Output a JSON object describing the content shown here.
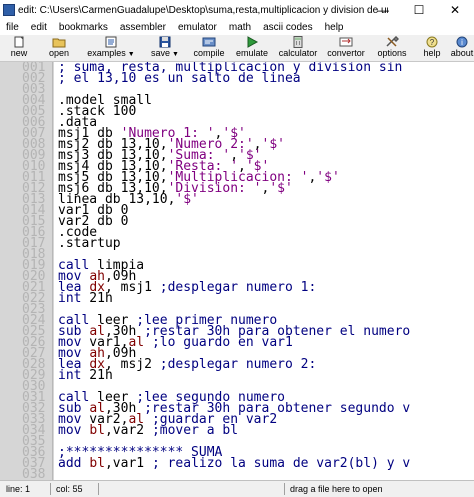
{
  "window": {
    "title": "edit: C:\\Users\\CarmenGuadalupe\\Desktop\\suma,resta,multiplicacion y division de un num de un...",
    "minimize": "—",
    "maximize": "☐",
    "close": "✕"
  },
  "menu": [
    "file",
    "edit",
    "bookmarks",
    "assembler",
    "emulator",
    "math",
    "ascii codes",
    "help"
  ],
  "toolbar": [
    {
      "label": "new",
      "icon": "new-file-icon",
      "dropdown": false
    },
    {
      "label": "open",
      "icon": "open-folder-icon",
      "dropdown": false
    },
    {
      "label": "examples",
      "icon": "examples-icon",
      "dropdown": true
    },
    {
      "label": "save",
      "icon": "save-disk-icon",
      "dropdown": true
    },
    {
      "label": "compile",
      "icon": "compile-icon",
      "dropdown": false
    },
    {
      "label": "emulate",
      "icon": "emulate-icon",
      "dropdown": false
    },
    {
      "label": "calculator",
      "icon": "calculator-icon",
      "dropdown": false
    },
    {
      "label": "convertor",
      "icon": "convertor-icon",
      "dropdown": false
    },
    {
      "label": "options",
      "icon": "options-icon",
      "dropdown": false
    },
    {
      "label": "help",
      "icon": "help-icon",
      "dropdown": false
    },
    {
      "label": "about",
      "icon": "about-icon",
      "dropdown": false
    }
  ],
  "colors": {
    "comment": "#000080",
    "directive": "#000000",
    "register": "#800000",
    "string": "#800080",
    "gutter": "#d6d6d6",
    "line_number": "#b4b4b4"
  },
  "editor": {
    "lines": [
      {
        "num": "001",
        "tokens": [
          {
            "t": "; suma, resta, multiplicacion y division sin",
            "c": "c"
          }
        ]
      },
      {
        "num": "002",
        "tokens": [
          {
            "t": "; el 13,10 es un salto de linea",
            "c": "c"
          }
        ]
      },
      {
        "num": "003",
        "tokens": []
      },
      {
        "num": "004",
        "tokens": [
          {
            "t": ".model small",
            "c": "d"
          }
        ]
      },
      {
        "num": "005",
        "tokens": [
          {
            "t": ".stack 100",
            "c": "d"
          }
        ]
      },
      {
        "num": "006",
        "tokens": [
          {
            "t": ".data",
            "c": "d"
          }
        ]
      },
      {
        "num": "007",
        "tokens": [
          {
            "t": "msj1 db ",
            "c": "d"
          },
          {
            "t": "'Numero 1: '",
            "c": "s"
          },
          {
            "t": ",",
            "c": "d"
          },
          {
            "t": "'$'",
            "c": "s"
          }
        ]
      },
      {
        "num": "008",
        "tokens": [
          {
            "t": "msj2 db 13,10,",
            "c": "d"
          },
          {
            "t": "'Numero 2:'",
            "c": "s"
          },
          {
            "t": ",",
            "c": "d"
          },
          {
            "t": "'$'",
            "c": "s"
          }
        ]
      },
      {
        "num": "009",
        "tokens": [
          {
            "t": "msj3 db 13,10,",
            "c": "d"
          },
          {
            "t": "'Suma: '",
            "c": "s"
          },
          {
            "t": ",",
            "c": "d"
          },
          {
            "t": "'$'",
            "c": "s"
          }
        ]
      },
      {
        "num": "010",
        "tokens": [
          {
            "t": "msj4 db 13,10,",
            "c": "d"
          },
          {
            "t": "'Resta: '",
            "c": "s"
          },
          {
            "t": ",",
            "c": "d"
          },
          {
            "t": "'$'",
            "c": "s"
          }
        ]
      },
      {
        "num": "011",
        "tokens": [
          {
            "t": "msj5 db 13,10,",
            "c": "d"
          },
          {
            "t": "'Multiplicacion: '",
            "c": "s"
          },
          {
            "t": ",",
            "c": "d"
          },
          {
            "t": "'$'",
            "c": "s"
          }
        ]
      },
      {
        "num": "012",
        "tokens": [
          {
            "t": "msj6 db 13,10,",
            "c": "d"
          },
          {
            "t": "'Division: '",
            "c": "s"
          },
          {
            "t": ",",
            "c": "d"
          },
          {
            "t": "'$'",
            "c": "s"
          }
        ]
      },
      {
        "num": "013",
        "tokens": [
          {
            "t": "linea db 13,10,",
            "c": "d"
          },
          {
            "t": "'$'",
            "c": "s"
          }
        ]
      },
      {
        "num": "014",
        "tokens": [
          {
            "t": "var1 db 0",
            "c": "d"
          }
        ]
      },
      {
        "num": "015",
        "tokens": [
          {
            "t": "var2 db 0",
            "c": "d"
          }
        ]
      },
      {
        "num": "016",
        "tokens": [
          {
            "t": ".code",
            "c": "d"
          }
        ]
      },
      {
        "num": "017",
        "tokens": [
          {
            "t": ".startup",
            "c": "d"
          }
        ]
      },
      {
        "num": "018",
        "tokens": []
      },
      {
        "num": "019",
        "tokens": [
          {
            "t": "call",
            "c": "c"
          },
          {
            "t": " limpia",
            "c": "d"
          }
        ]
      },
      {
        "num": "020",
        "tokens": [
          {
            "t": "mov",
            "c": "c"
          },
          {
            "t": " ",
            "c": "d"
          },
          {
            "t": "ah",
            "c": "r"
          },
          {
            "t": ",09h",
            "c": "d"
          }
        ]
      },
      {
        "num": "021",
        "tokens": [
          {
            "t": "lea",
            "c": "c"
          },
          {
            "t": " ",
            "c": "d"
          },
          {
            "t": "dx",
            "c": "r"
          },
          {
            "t": ", msj1 ",
            "c": "d"
          },
          {
            "t": ";desplegar numero 1:",
            "c": "c"
          }
        ]
      },
      {
        "num": "022",
        "tokens": [
          {
            "t": "int",
            "c": "c"
          },
          {
            "t": " 21h",
            "c": "d"
          }
        ]
      },
      {
        "num": "023",
        "tokens": []
      },
      {
        "num": "024",
        "tokens": [
          {
            "t": "call",
            "c": "c"
          },
          {
            "t": " leer ",
            "c": "d"
          },
          {
            "t": ";lee primer numero",
            "c": "c"
          }
        ]
      },
      {
        "num": "025",
        "tokens": [
          {
            "t": "sub",
            "c": "c"
          },
          {
            "t": " ",
            "c": "d"
          },
          {
            "t": "al",
            "c": "r"
          },
          {
            "t": ",30h ",
            "c": "d"
          },
          {
            "t": ";restar 30h para obtener el numero",
            "c": "c"
          }
        ]
      },
      {
        "num": "026",
        "tokens": [
          {
            "t": "mov",
            "c": "c"
          },
          {
            "t": " var1,",
            "c": "d"
          },
          {
            "t": "al",
            "c": "r"
          },
          {
            "t": " ",
            "c": "d"
          },
          {
            "t": ";lo guardo en var1",
            "c": "c"
          }
        ]
      },
      {
        "num": "027",
        "tokens": [
          {
            "t": "mov",
            "c": "c"
          },
          {
            "t": " ",
            "c": "d"
          },
          {
            "t": "ah",
            "c": "r"
          },
          {
            "t": ",09h",
            "c": "d"
          }
        ]
      },
      {
        "num": "028",
        "tokens": [
          {
            "t": "lea",
            "c": "c"
          },
          {
            "t": " ",
            "c": "d"
          },
          {
            "t": "dx",
            "c": "r"
          },
          {
            "t": ", msj2 ",
            "c": "d"
          },
          {
            "t": ";desplegar numero 2:",
            "c": "c"
          }
        ]
      },
      {
        "num": "029",
        "tokens": [
          {
            "t": "int",
            "c": "c"
          },
          {
            "t": " 21h",
            "c": "d"
          }
        ]
      },
      {
        "num": "030",
        "tokens": []
      },
      {
        "num": "031",
        "tokens": [
          {
            "t": "call",
            "c": "c"
          },
          {
            "t": " leer ",
            "c": "d"
          },
          {
            "t": ";lee segundo numero",
            "c": "c"
          }
        ]
      },
      {
        "num": "032",
        "tokens": [
          {
            "t": "sub",
            "c": "c"
          },
          {
            "t": " ",
            "c": "d"
          },
          {
            "t": "al",
            "c": "r"
          },
          {
            "t": ",30h ",
            "c": "d"
          },
          {
            "t": ";restar 30h para obtener segundo v",
            "c": "c"
          }
        ]
      },
      {
        "num": "033",
        "tokens": [
          {
            "t": "mov",
            "c": "c"
          },
          {
            "t": " var2,",
            "c": "d"
          },
          {
            "t": "al",
            "c": "r"
          },
          {
            "t": " ",
            "c": "d"
          },
          {
            "t": ";guardar en var2",
            "c": "c"
          }
        ]
      },
      {
        "num": "034",
        "tokens": [
          {
            "t": "mov",
            "c": "c"
          },
          {
            "t": " ",
            "c": "d"
          },
          {
            "t": "bl",
            "c": "r"
          },
          {
            "t": ",var2 ",
            "c": "d"
          },
          {
            "t": ";mover a bl",
            "c": "c"
          }
        ]
      },
      {
        "num": "035",
        "tokens": []
      },
      {
        "num": "036",
        "tokens": [
          {
            "t": ";*************** SUMA",
            "c": "c"
          }
        ]
      },
      {
        "num": "037",
        "tokens": [
          {
            "t": "add",
            "c": "c"
          },
          {
            "t": " ",
            "c": "d"
          },
          {
            "t": "bl",
            "c": "r"
          },
          {
            "t": ",var1 ",
            "c": "d"
          },
          {
            "t": "; realizo la suma de var2(bl) y v",
            "c": "c"
          }
        ]
      },
      {
        "num": "038",
        "tokens": []
      }
    ]
  },
  "status": {
    "line": "line: 1",
    "col": "col: 55",
    "hint": "drag a file here to open"
  }
}
